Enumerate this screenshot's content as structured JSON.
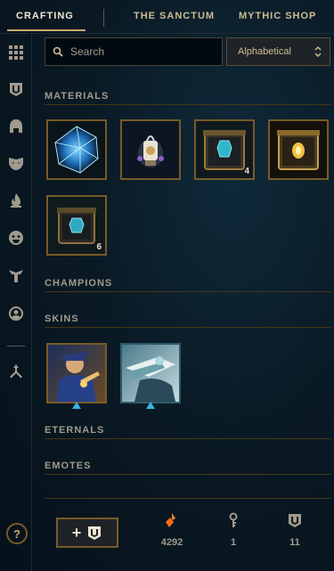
{
  "nav": {
    "tabs": [
      {
        "label": "CRAFTING",
        "active": true
      },
      {
        "label": "THE SANCTUM",
        "active": false
      },
      {
        "label": "MYTHIC SHOP",
        "active": false
      }
    ]
  },
  "sidebar": {
    "icons": [
      "grid-icon",
      "chest-icon",
      "helmet-icon",
      "mask-icon",
      "ward-icon",
      "emote-face-icon",
      "summoner-icon",
      "profile-icon",
      "merge-icon"
    ]
  },
  "search": {
    "placeholder": "Search"
  },
  "sort": {
    "value": "Alphabetical"
  },
  "sections": {
    "materials": "MATERIALS",
    "champions": "CHAMPIONS",
    "skins": "SKINS",
    "eternals": "ETERNALS",
    "emotes": "EMOTES"
  },
  "materials": [
    {
      "name": "blue-essence-crystal",
      "count": ""
    },
    {
      "name": "lantern-token",
      "count": ""
    },
    {
      "name": "key-fragment-chest",
      "count": "4"
    },
    {
      "name": "golden-chest",
      "count": ""
    },
    {
      "name": "hextech-chest",
      "count": "6"
    }
  ],
  "skins": [
    {
      "name": "skin-shard-1"
    },
    {
      "name": "skin-shard-2"
    }
  ],
  "bottom": {
    "help": "?",
    "add_label": "+",
    "currencies": [
      {
        "name": "orange-essence",
        "value": "4292",
        "color": "#ff7a1a"
      },
      {
        "name": "key",
        "value": "1",
        "color": "#a09b8c"
      },
      {
        "name": "chest",
        "value": "11",
        "color": "#a09b8c"
      }
    ]
  }
}
